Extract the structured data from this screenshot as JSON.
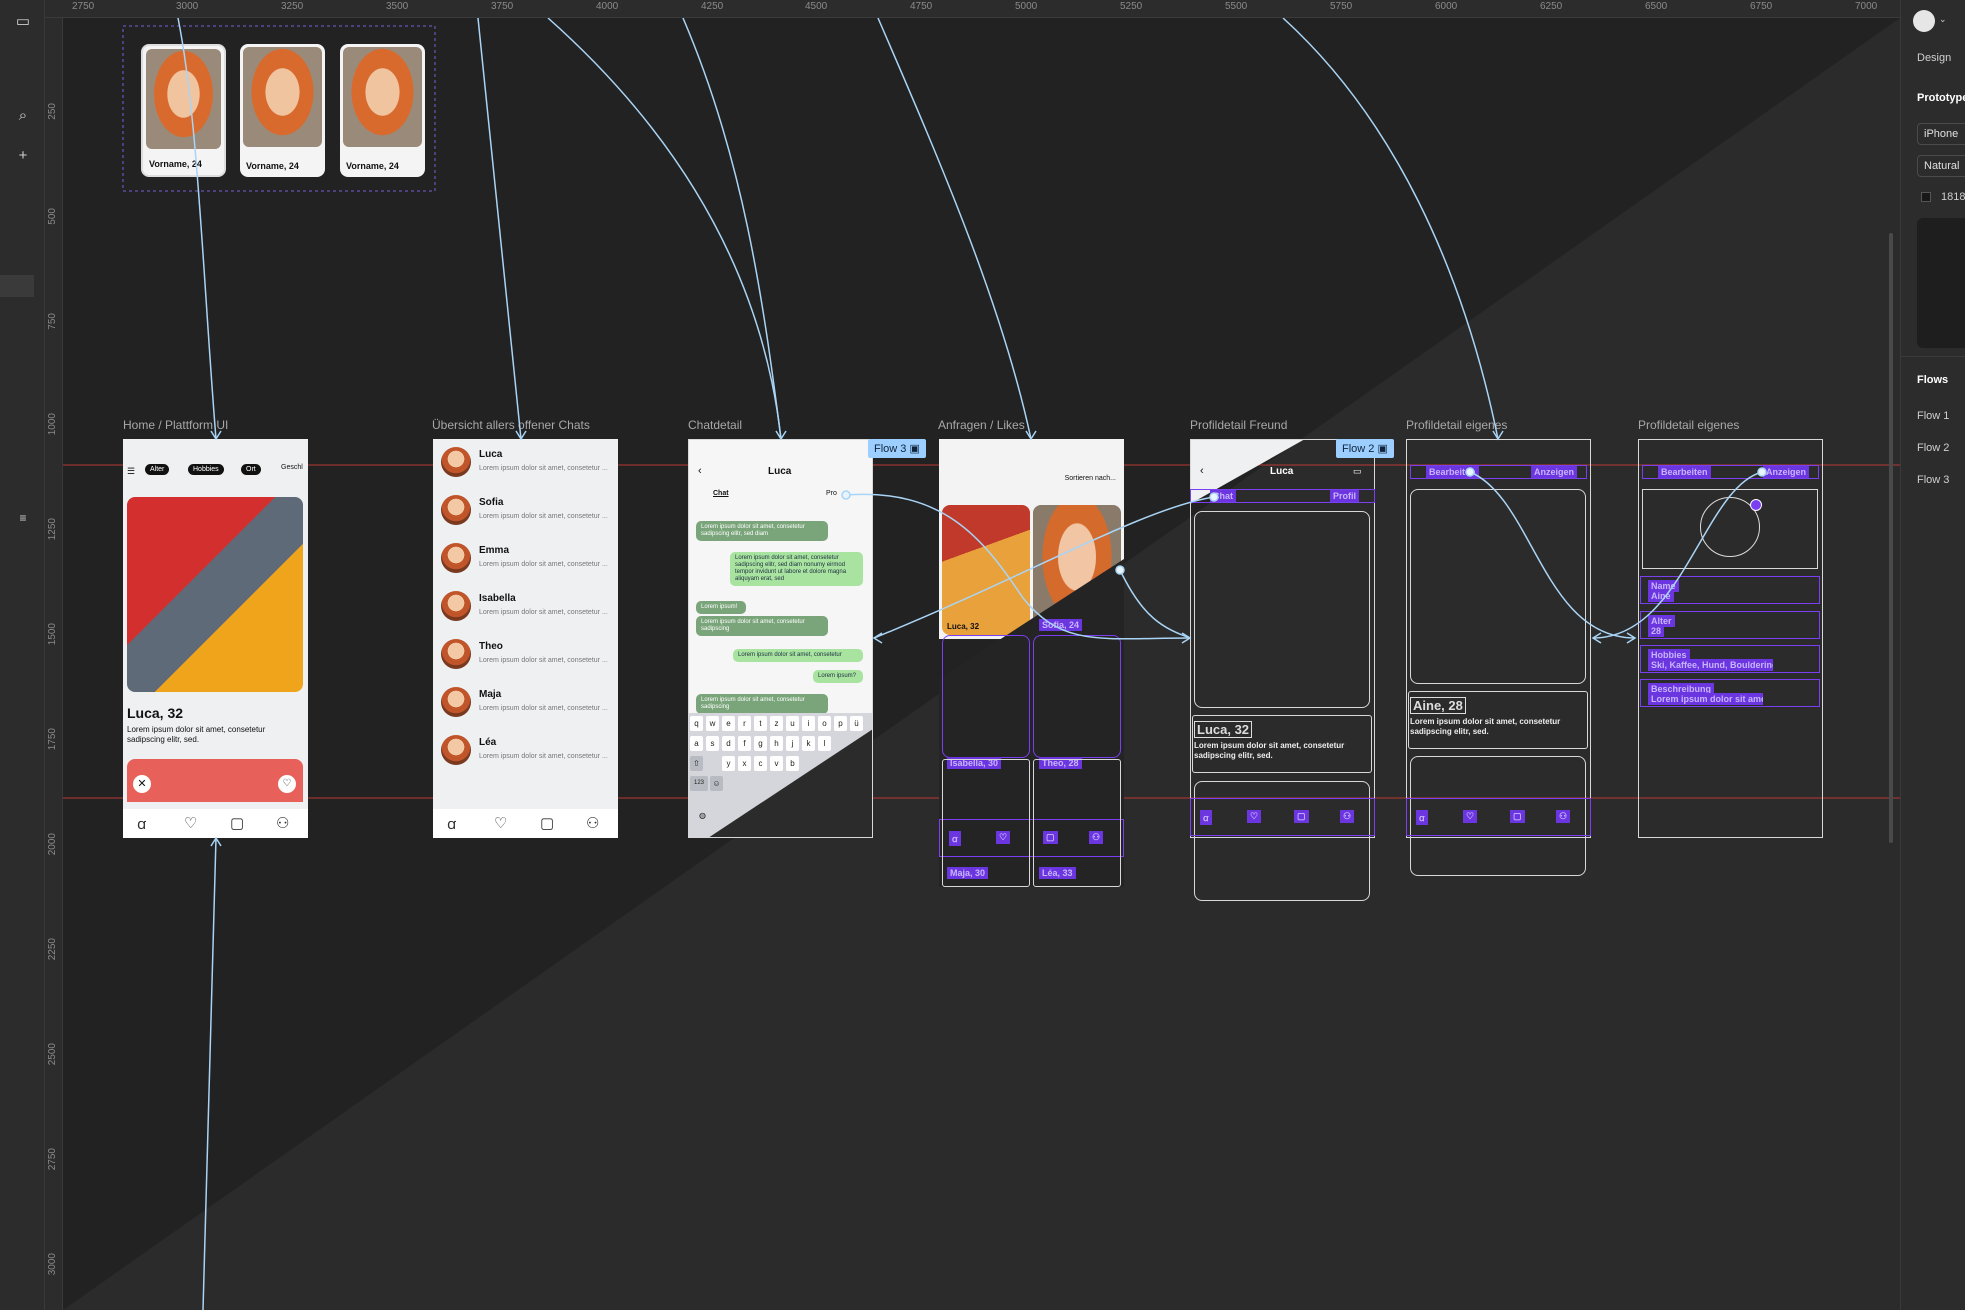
{
  "ruler": {
    "top_ticks": [
      "2750",
      "3000",
      "3250",
      "3500",
      "3750",
      "4000",
      "4250",
      "4500",
      "4750",
      "5000",
      "5250",
      "5500",
      "5750",
      "6000",
      "6250",
      "6500",
      "6750",
      "7000"
    ],
    "left_ticks": [
      "250",
      "500",
      "750",
      "1000",
      "1250",
      "1500",
      "1750",
      "2000",
      "2250",
      "2500",
      "2750",
      "3000"
    ]
  },
  "right_panel": {
    "tab_design": "Design",
    "tab_prototype": "Prototype",
    "device": "iPhone",
    "scaling": "Natural",
    "bg_hex": "1818",
    "flows_title": "Flows",
    "flows": [
      "Flow 1",
      "Flow 2",
      "Flow 3"
    ]
  },
  "top_cards": [
    "Vorname, 24",
    "Vorname, 24",
    "Vorname, 24"
  ],
  "frames": {
    "home": {
      "label": "Home / Plattform UI",
      "filters": [
        "Alter",
        "Hobbies",
        "Ort",
        "Geschl"
      ],
      "name": "Luca, 32",
      "desc": "Lorem ipsum dolor sit amet, consetetur sadipscing elitr, sed."
    },
    "chats": {
      "label": "Übersicht allers offener Chats",
      "preview": "Lorem ipsum dolor sit amet, consetetur ...",
      "names": [
        "Luca",
        "Sofia",
        "Emma",
        "Isabella",
        "Theo",
        "Maja",
        "Léa"
      ]
    },
    "chatdetail": {
      "label": "Chatdetail",
      "title": "Luca",
      "tab_chat": "Chat",
      "tab_profile": "Pro",
      "b1": "Lorem ipsum dolor sit amet, consetetur sadipscing elitr, sed diam",
      "b2": "Lorem ipsum dolor sit amet, consetetur sadipscing elitr, sed diam nonumy eirmod tempor invidunt ut labore et dolore magna aliquyam erat, sed",
      "b3": "Lorem ipsum!",
      "b4": "Lorem ipsum dolor sit amet, consetetur sadipscing",
      "b5": "Lorem ipsum dolor sit amet, consetetur",
      "b6": "Lorem ipsum?",
      "b7": "Lorem ipsum dolor sit amet, consetetur sadipscing",
      "keys_row1": [
        "q",
        "w",
        "e",
        "r",
        "t",
        "z",
        "u",
        "i",
        "o",
        "p",
        "ü"
      ],
      "keys_row2": [
        "a",
        "s",
        "d",
        "f",
        "g",
        "h",
        "j",
        "k",
        "l"
      ],
      "keys_row3": [
        "y",
        "x",
        "c",
        "v",
        "b"
      ],
      "key_123": "123"
    },
    "likes": {
      "label": "Anfragen / Likes",
      "sort": "Sortieren nach...",
      "card1": "Luca, 32",
      "card2": "Sofia, 24",
      "card3": "Isabella, 30",
      "card4": "Theo, 28",
      "card5": "Maja, 30",
      "card6": "Léa, 33"
    },
    "friend": {
      "label": "Profildetail Freund",
      "title": "Luca",
      "tab_chat": "Chat",
      "tab_profile": "Profil",
      "name": "Luca, 32",
      "desc": "Lorem ipsum dolor sit amet, consetetur sadipscing elitr, sed."
    },
    "own1": {
      "label": "Profildetail eigenes",
      "tab_edit": "Bearbeiten",
      "tab_view": "Anzeigen",
      "name": "Aine, 28",
      "desc": "Lorem ipsum dolor sit amet, consetetur sadipscing elitr, sed."
    },
    "own2": {
      "label": "Profildetail eigenes",
      "tab_edit": "Bearbeiten",
      "tab_view": "Anzeigen",
      "f1_label": "Name",
      "f1_val": "Aine",
      "f2_label": "Alter",
      "f2_val": "28",
      "f3_label": "Hobbies",
      "f3_val": "Ski, Kaffee, Hund, Bouldering...",
      "f4_label": "Beschreibung",
      "f4_val": "Lorem ipsum dolor sit ame..."
    }
  },
  "flow_tags": [
    "Flow 3",
    "Flow 2"
  ],
  "colors": {
    "accent": "#7b3ff2",
    "flow": "#9ccfff",
    "connector": "#a9d4f5",
    "guide": "#c0392b"
  }
}
